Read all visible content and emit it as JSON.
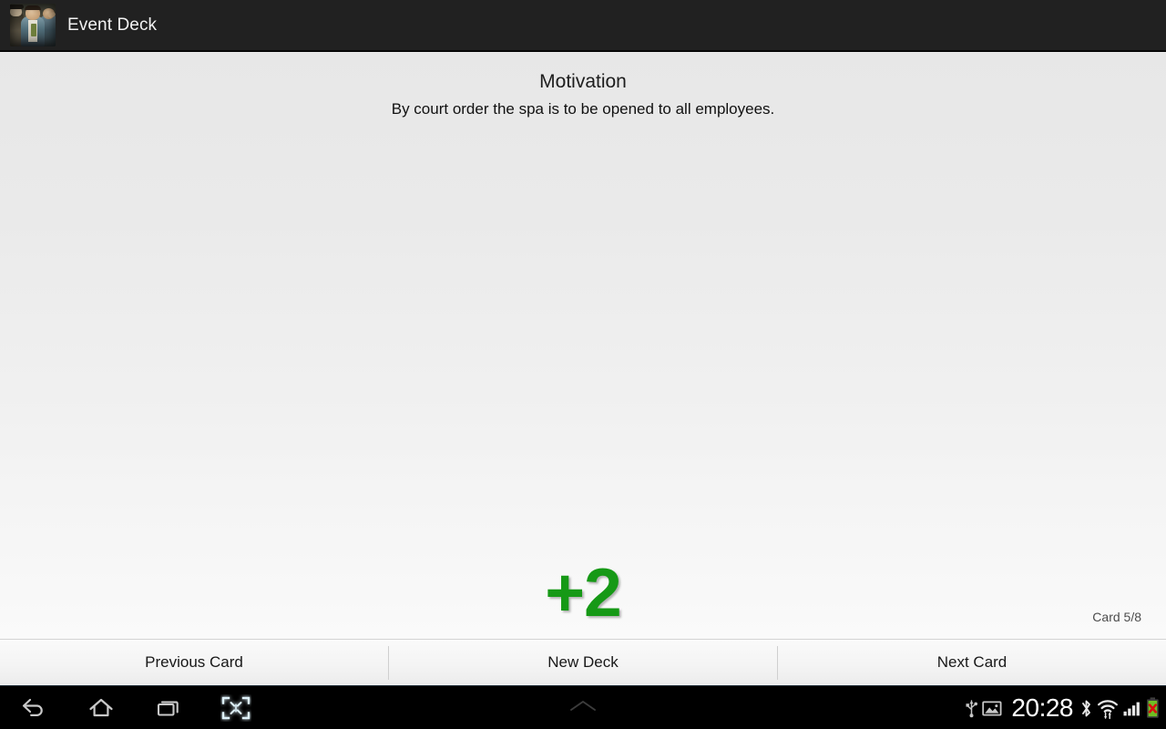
{
  "action_bar": {
    "app_icon_name": "event-deck-app-icon",
    "title": "Event Deck"
  },
  "card": {
    "title": "Motivation",
    "description": "By court order the spa is to be opened to all employees.",
    "value": "+2",
    "value_color": "#169916",
    "counter": "Card 5/8"
  },
  "button_bar": {
    "previous_label": "Previous Card",
    "new_deck_label": "New Deck",
    "next_label": "Next Card"
  },
  "nav_bar": {
    "back_icon": "back-icon",
    "home_icon": "home-icon",
    "recents_icon": "recent-apps-icon",
    "shrink_icon": "shrink-screen-icon",
    "drawer_handle_icon": "chevron-up-icon"
  },
  "status_bar": {
    "usb_icon": "usb-icon",
    "screenshot_icon": "screenshot-image-icon",
    "clock": "20:28",
    "bluetooth_icon": "bluetooth-icon",
    "wifi_icon": "wifi-icon",
    "signal_icon": "cellular-signal-icon",
    "battery_icon": "battery-error-icon"
  }
}
